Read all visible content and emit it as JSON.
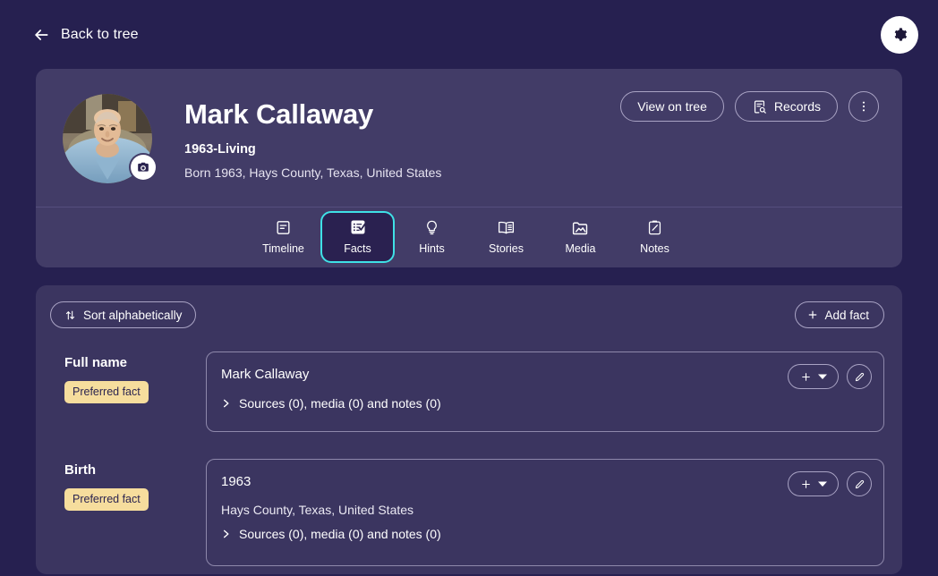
{
  "topbar": {
    "back_label": "Back to tree",
    "back_icon": "arrow-left-icon",
    "settings_icon": "gear-icon"
  },
  "person": {
    "name": "Mark Callaway",
    "dates": "1963-Living",
    "born": "Born 1963, Hays County, Texas, United States",
    "avatar_alt": "portrait-photo",
    "camera_icon": "camera-icon",
    "actions": {
      "view_on_tree": "View on tree",
      "records": "Records",
      "records_icon": "records-search-icon",
      "more_icon": "more-vertical-icon"
    }
  },
  "tabs": [
    {
      "label": "Timeline",
      "icon": "timeline-icon",
      "active": false
    },
    {
      "label": "Facts",
      "icon": "checklist-icon",
      "active": true
    },
    {
      "label": "Hints",
      "icon": "lightbulb-icon",
      "active": false
    },
    {
      "label": "Stories",
      "icon": "book-icon",
      "active": false
    },
    {
      "label": "Media",
      "icon": "media-folder-icon",
      "active": false
    },
    {
      "label": "Notes",
      "icon": "notes-pencil-icon",
      "active": false
    }
  ],
  "toolbar": {
    "sort_label": "Sort alphabetically",
    "sort_icon": "sort-arrows-icon",
    "add_fact_label": "Add fact",
    "add_icon": "plus-icon"
  },
  "facts": [
    {
      "type": "Full name",
      "badge": "Preferred fact",
      "value": "Mark Callaway",
      "place": "",
      "sources": "Sources (0), media (0) and notes (0)",
      "chevron_icon": "chevron-right-icon",
      "add_icon": "plus-icon",
      "dropdown_icon": "caret-down-icon",
      "edit_icon": "pencil-icon"
    },
    {
      "type": "Birth",
      "badge": "Preferred fact",
      "value": "1963",
      "place": "Hays County, Texas, United States",
      "sources": "Sources (0), media (0) and notes (0)",
      "chevron_icon": "chevron-right-icon",
      "add_icon": "plus-icon",
      "dropdown_icon": "caret-down-icon",
      "edit_icon": "pencil-icon"
    }
  ],
  "colors": {
    "page_bg": "#262050",
    "card_bg": "#423c67",
    "panel_bg": "#3b3560",
    "accent": "#3fe1e6",
    "badge_bg": "#f6dd9d",
    "border": "#a9a3c4"
  }
}
